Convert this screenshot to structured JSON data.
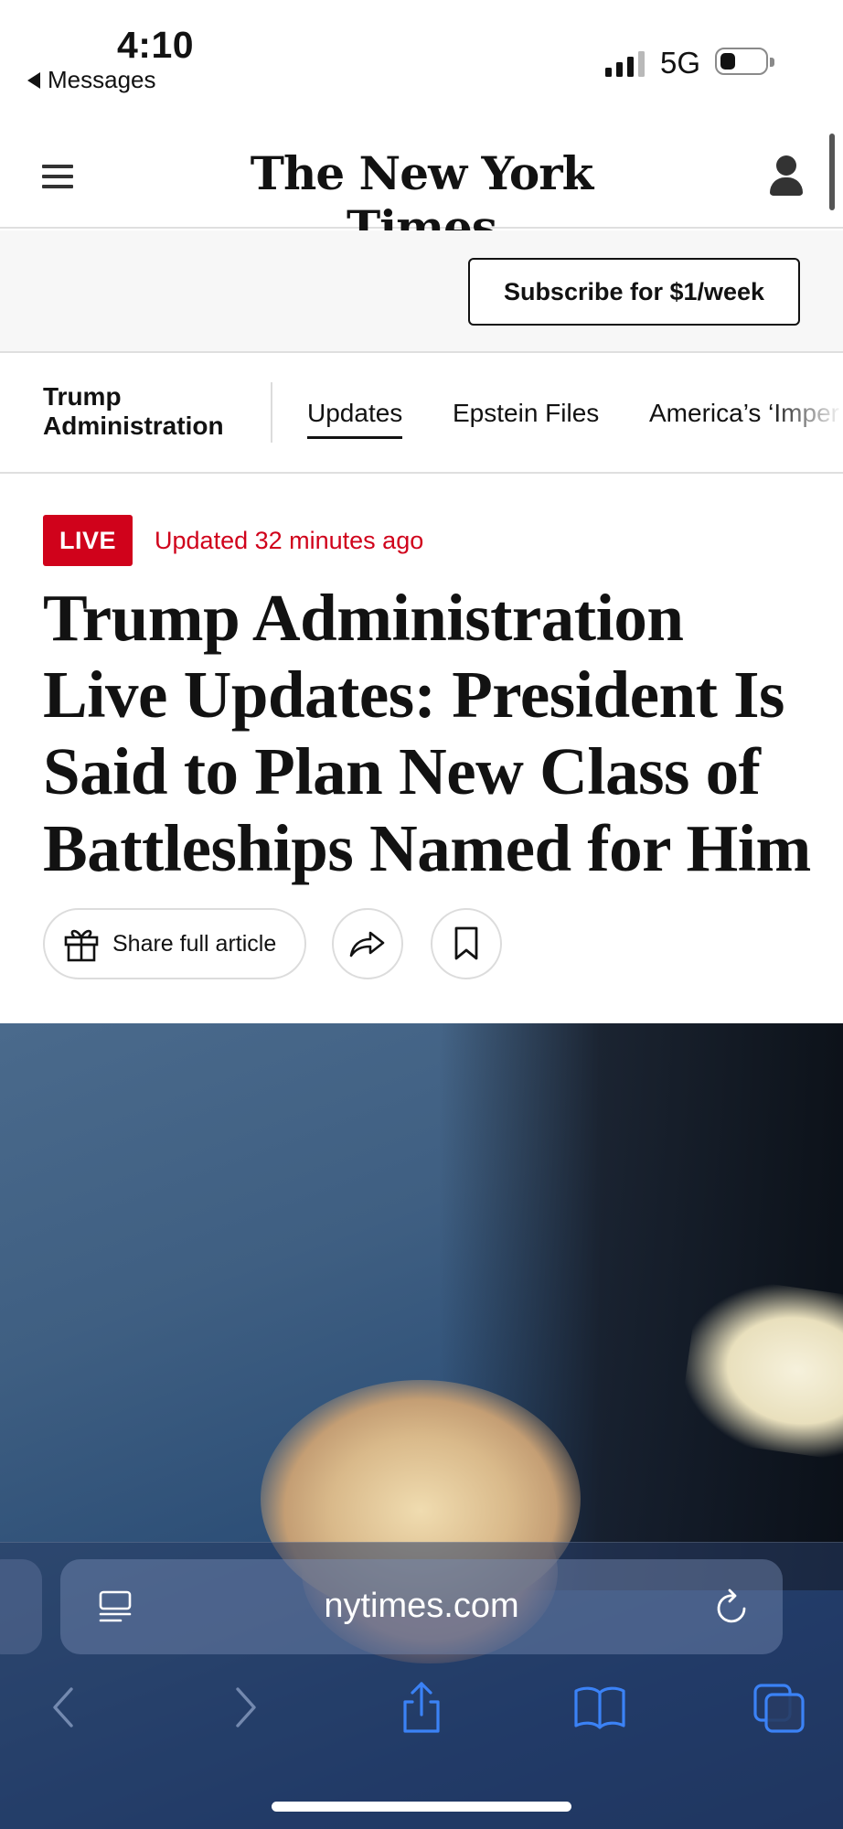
{
  "status_bar": {
    "time": "4:10",
    "back_app": "Messages",
    "network": "5G",
    "battery_level": 0.35
  },
  "header": {
    "logo_text": "The New York Times",
    "subscribe_label": "Subscribe for $1/week"
  },
  "section_nav": {
    "section_title": "Trump Administration",
    "tabs": [
      {
        "label": "Updates",
        "active": true
      },
      {
        "label": "Epstein Files",
        "active": false
      },
      {
        "label": "America’s ‘Imper",
        "active": false
      }
    ]
  },
  "article": {
    "live_label": "LIVE",
    "updated": "Updated 32 minutes ago",
    "headline": "Trump Administration Live Updates: President Is Said to Plan New Class of Battleships Named for Him",
    "share_full_label": "Share full article"
  },
  "browser": {
    "url": "nytimes.com"
  },
  "colors": {
    "live_red": "#d0021b",
    "toolbar_icon_blue": "#3b82f6"
  },
  "icons": [
    "menu-icon",
    "account-icon",
    "gift-icon",
    "share-icon",
    "bookmark-icon",
    "reader-icon",
    "reload-icon",
    "back-icon",
    "forward-icon",
    "share-sheet-icon",
    "bookmarks-icon",
    "tabs-icon"
  ]
}
